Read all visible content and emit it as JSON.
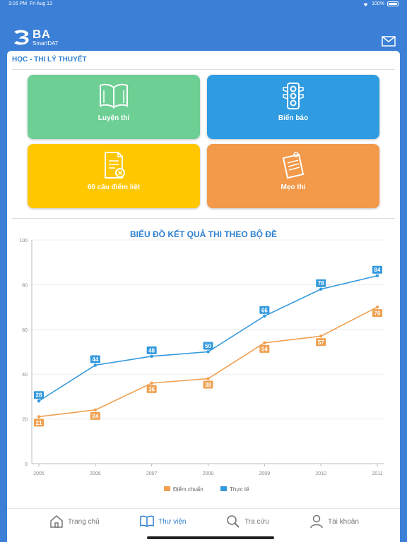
{
  "status": {
    "time": "3:16 PM",
    "date": "Fri Aug 13",
    "battery": "100%"
  },
  "brand": {
    "name": "BA",
    "sub": "SmartDAT"
  },
  "icons": {
    "mail": "mail-icon"
  },
  "section": {
    "title": "HỌC - THI LÝ THUYẾT"
  },
  "tiles": [
    {
      "label": "Luyện thi",
      "color": "#6dcf94",
      "icon": "book-icon"
    },
    {
      "label": "Biển báo",
      "color": "#2f9be0",
      "icon": "traffic-light-icon"
    },
    {
      "label": "60 câu điểm liệt",
      "color": "#ffc700",
      "icon": "document-x-icon"
    },
    {
      "label": "Mẹo thi",
      "color": "#f3994a",
      "icon": "notepad-icon"
    }
  ],
  "chart_data": {
    "type": "line",
    "title": "BIỂU ĐỒ KẾT QUẢ THI THEO BỘ ĐỀ",
    "x": [
      "2005",
      "2006",
      "2007",
      "2008",
      "2009",
      "2010",
      "2011"
    ],
    "ylim": [
      0,
      100
    ],
    "yticks": [
      "0",
      "20",
      "40",
      "60",
      "80",
      "100"
    ],
    "grid": true,
    "legend": "bottom",
    "series": [
      {
        "name": "Điểm chuẩn",
        "color": "#f0a050",
        "values": [
          21,
          24,
          36,
          38,
          54,
          57,
          70
        ]
      },
      {
        "name": "Thực tế",
        "color": "#3399dd",
        "values": [
          28,
          44,
          48,
          50,
          66,
          78,
          84
        ]
      }
    ]
  },
  "nav": [
    {
      "label": "Trang chủ",
      "icon": "home-icon",
      "active": false
    },
    {
      "label": "Thư viện",
      "icon": "library-book-icon",
      "active": true
    },
    {
      "label": "Tra cứu",
      "icon": "search-icon",
      "active": false
    },
    {
      "label": "Tài khoản",
      "icon": "user-icon",
      "active": false
    }
  ]
}
